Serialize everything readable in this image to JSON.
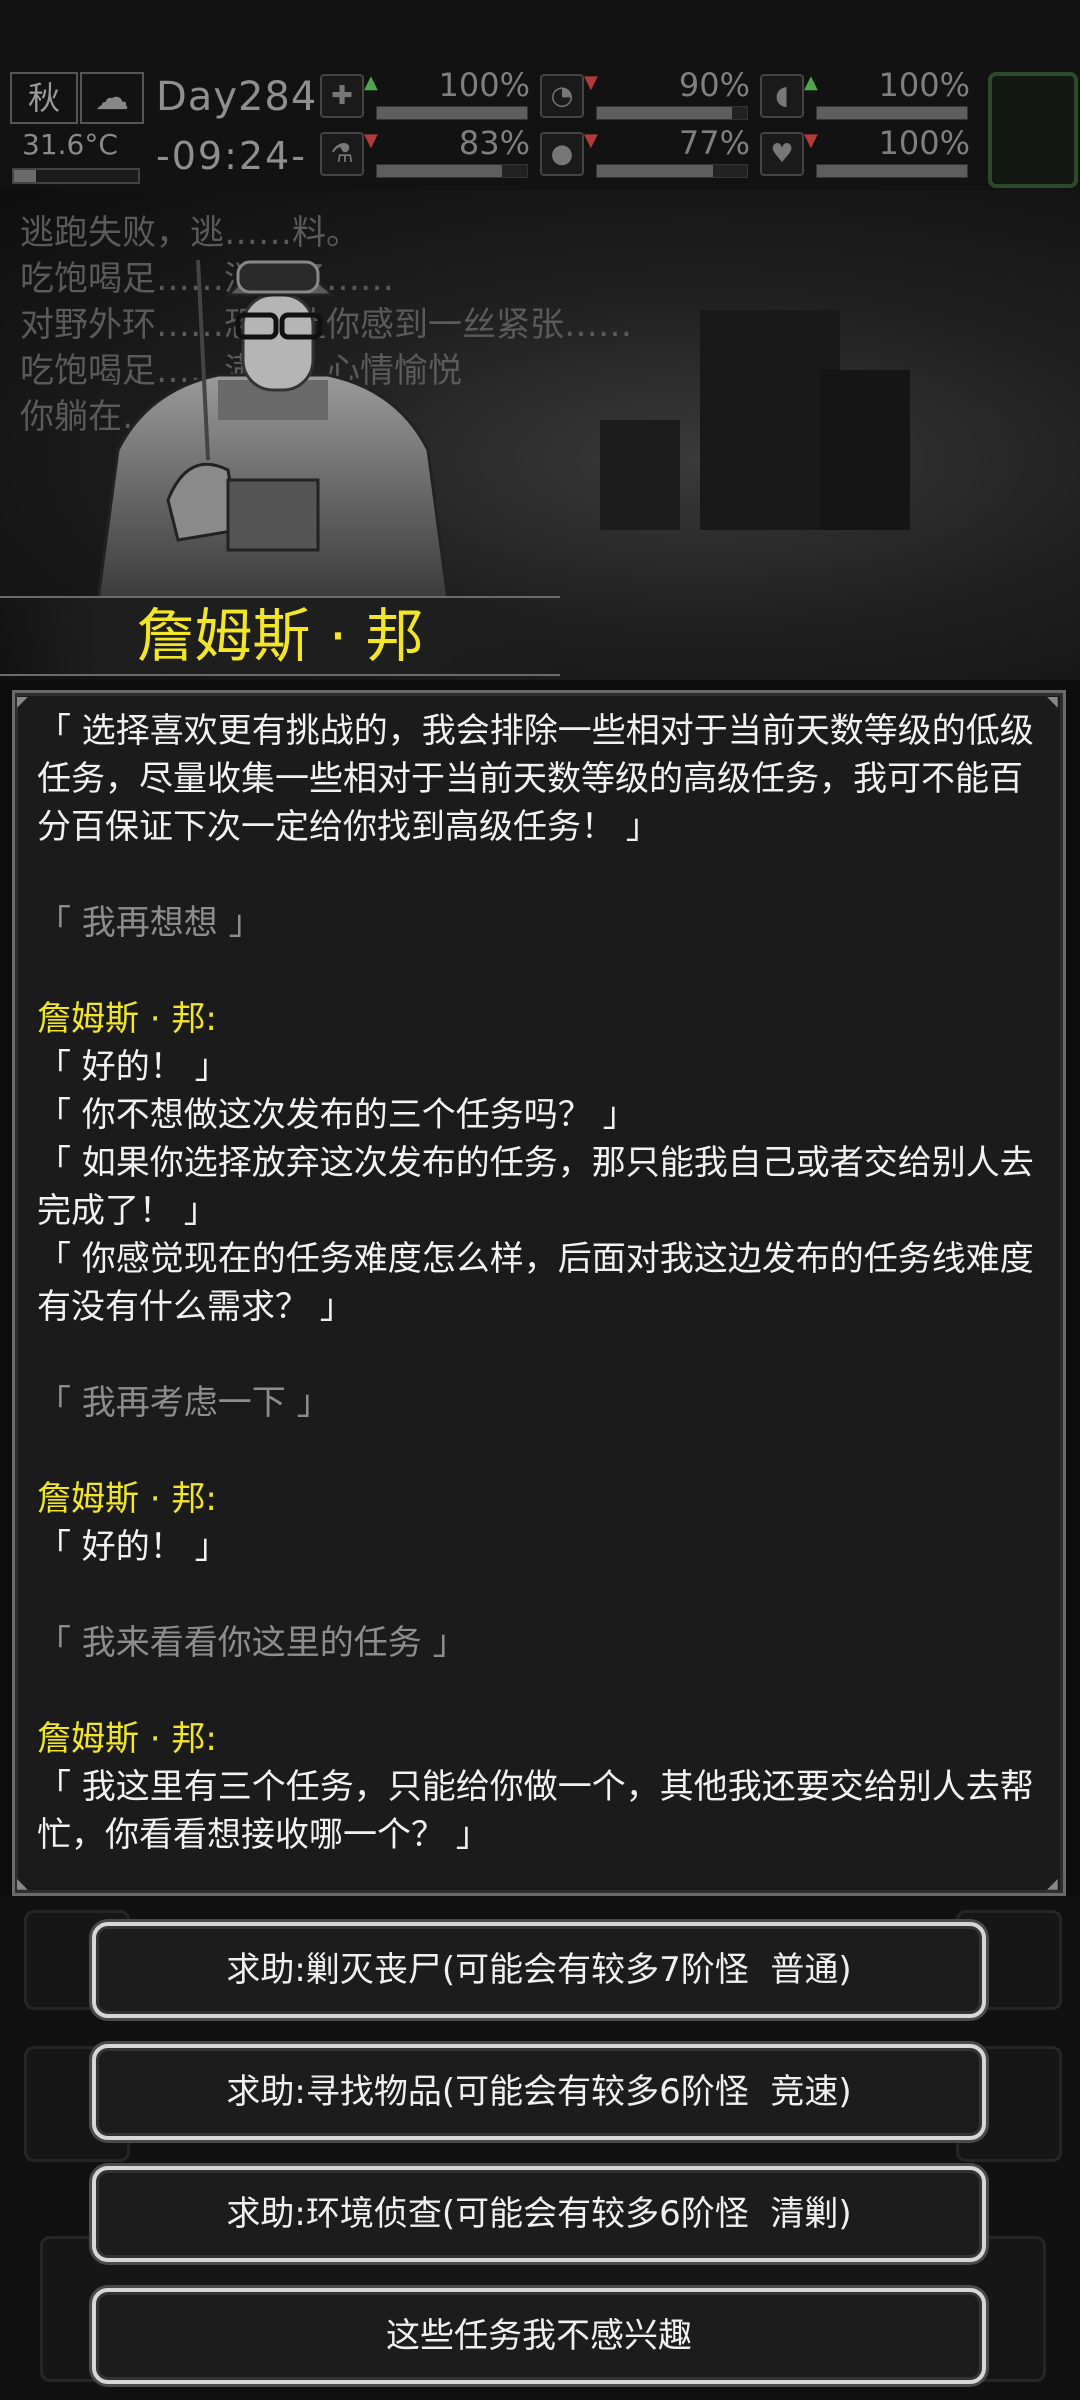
{
  "status": {
    "season": "秋",
    "temperature": "31.6°C",
    "day": "Day284",
    "time": "-09:24-",
    "stats": [
      {
        "icon": "medkit-icon",
        "glyph": "✚",
        "trend": "up",
        "value": "100%",
        "fill": 1.0
      },
      {
        "icon": "stomach-icon",
        "glyph": "◔",
        "trend": "down",
        "value": "90%",
        "fill": 0.9
      },
      {
        "icon": "pill-icon",
        "glyph": "◖",
        "trend": "up",
        "value": "100%",
        "fill": 1.0
      },
      {
        "icon": "flask-icon",
        "glyph": "⚗",
        "trend": "down",
        "value": "83%",
        "fill": 0.83
      },
      {
        "icon": "water-drop-icon",
        "glyph": "💧",
        "trend": "down",
        "value": "77%",
        "fill": 0.77
      },
      {
        "icon": "heart-icon",
        "glyph": "♥",
        "trend": "down",
        "value": "100%",
        "fill": 1.0
      }
    ]
  },
  "log_lines": [
    "逃跑失败，逃……料。",
    "吃饱喝足……消失了……",
    "对野外环……恐惧让你感到一丝紧张……",
    "吃饱喝足……满足，心情愉悦",
    "你躺在……"
  ],
  "npc_name": "詹姆斯 · 邦",
  "dialog": {
    "block1": "「 选择喜欢更有挑战的，我会排除一些相对于当前天数等级的低级任务，尽量收集一些相对于当前天数等级的高级任务，我可不能百分百保证下次一定给你找到高级任务！ 」",
    "player1": "「 我再想想 」",
    "speaker": "詹姆斯 · 邦:",
    "npc2_l1": "「 好的！ 」",
    "npc2_l2": "「 你不想做这次发布的三个任务吗？ 」",
    "npc2_l3": "「 如果你选择放弃这次发布的任务，那只能我自己或者交给别人去完成了！ 」",
    "npc2_l4": "「 你感觉现在的任务难度怎么样，后面对我这边发布的任务线难度有没有什么需求？ 」",
    "player2": "「 我再考虑一下 」",
    "npc3_l1": "「 好的！ 」",
    "player3": "「 我来看看你这里的任务 」",
    "npc4_l1": "「 我这里有三个任务，只能给你做一个，其他我还要交给别人去帮忙，你看看想接收哪一个？ 」"
  },
  "choices": {
    "c1": "求助:剿灭丧尸(可能会有较多7阶怪  普通)",
    "c2": "求助:寻找物品(可能会有较多6阶怪  竞速)",
    "c3": "求助:环境侦查(可能会有较多6阶怪  清剿)",
    "c4": "这些任务我不感兴趣"
  }
}
